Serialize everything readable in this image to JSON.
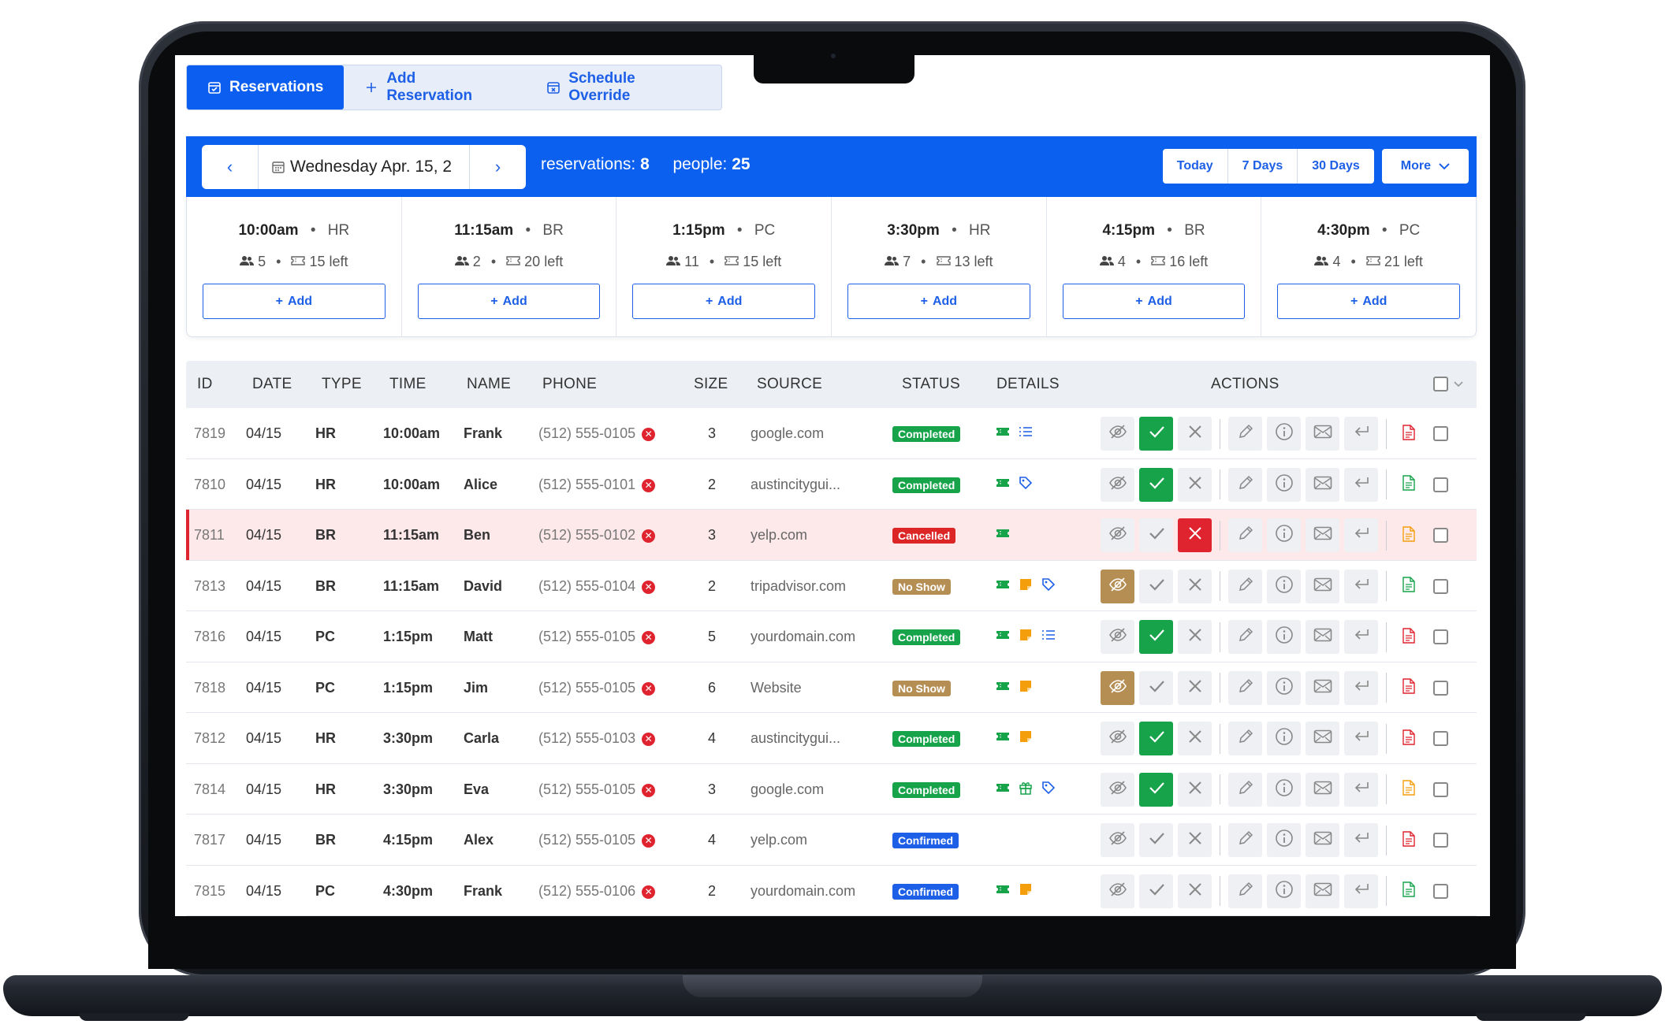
{
  "tabs": [
    {
      "label": "Reservations",
      "active": true,
      "icon": "calendar-check-icon"
    },
    {
      "label": "Add Reservation",
      "active": false,
      "icon": "plus-icon"
    },
    {
      "label": "Schedule Override",
      "active": false,
      "icon": "calendar-x-icon"
    }
  ],
  "date_nav": {
    "date_label": "Wednesday Apr. 15, 2"
  },
  "summary": {
    "reservations_label": "reservations:",
    "reservations_count": "8",
    "people_label": "people:",
    "people_count": "25"
  },
  "range_buttons": [
    "Today",
    "7 Days",
    "30 Days"
  ],
  "more_label": "More",
  "slots": [
    {
      "time": "10:00am",
      "type": "HR",
      "people": "5",
      "left": "15 left",
      "add": "Add"
    },
    {
      "time": "11:15am",
      "type": "BR",
      "people": "2",
      "left": "20 left",
      "add": "Add"
    },
    {
      "time": "1:15pm",
      "type": "PC",
      "people": "11",
      "left": "15 left",
      "add": "Add"
    },
    {
      "time": "3:30pm",
      "type": "HR",
      "people": "7",
      "left": "13 left",
      "add": "Add"
    },
    {
      "time": "4:15pm",
      "type": "BR",
      "people": "4",
      "left": "16 left",
      "add": "Add"
    },
    {
      "time": "4:30pm",
      "type": "PC",
      "people": "4",
      "left": "21 left",
      "add": "Add"
    }
  ],
  "columns": {
    "id": "ID",
    "date": "DATE",
    "type": "TYPE",
    "time": "TIME",
    "name": "NAME",
    "phone": "PHONE",
    "size": "SIZE",
    "source": "SOURCE",
    "status": "STATUS",
    "details": "DETAILS",
    "actions": "ACTIONS"
  },
  "rows": [
    {
      "id": "7819",
      "date": "04/15",
      "type": "HR",
      "time": "10:00am",
      "name": "Frank",
      "phone": "(512) 555-0105",
      "size": "3",
      "source": "google.com",
      "status": "Completed",
      "status_kind": "completed",
      "details": [
        "ticket",
        "list"
      ],
      "state": "done",
      "pdf": "red"
    },
    {
      "id": "7810",
      "date": "04/15",
      "type": "HR",
      "time": "10:00am",
      "name": "Alice",
      "phone": "(512) 555-0101",
      "size": "2",
      "source": "austincitygui...",
      "status": "Completed",
      "status_kind": "completed",
      "details": [
        "ticket",
        "tag"
      ],
      "state": "done",
      "pdf": "green"
    },
    {
      "id": "7811",
      "date": "04/15",
      "type": "BR",
      "time": "11:15am",
      "name": "Ben",
      "phone": "(512) 555-0102",
      "size": "3",
      "source": "yelp.com",
      "status": "Cancelled",
      "status_kind": "cancelled",
      "details": [
        "ticket"
      ],
      "state": "cancel",
      "pdf": "orange"
    },
    {
      "id": "7813",
      "date": "04/15",
      "type": "BR",
      "time": "11:15am",
      "name": "David",
      "phone": "(512) 555-0104",
      "size": "2",
      "source": "tripadvisor.com",
      "status": "No Show",
      "status_kind": "noshow",
      "details": [
        "ticket",
        "note",
        "tag"
      ],
      "state": "noshow",
      "pdf": "green"
    },
    {
      "id": "7816",
      "date": "04/15",
      "type": "PC",
      "time": "1:15pm",
      "name": "Matt",
      "phone": "(512) 555-0105",
      "size": "5",
      "source": "yourdomain.com",
      "status": "Completed",
      "status_kind": "completed",
      "details": [
        "ticket",
        "note",
        "list"
      ],
      "state": "done",
      "pdf": "red"
    },
    {
      "id": "7818",
      "date": "04/15",
      "type": "PC",
      "time": "1:15pm",
      "name": "Jim",
      "phone": "(512) 555-0105",
      "size": "6",
      "source": "Website",
      "status": "No Show",
      "status_kind": "noshow",
      "details": [
        "ticket",
        "note"
      ],
      "state": "noshow",
      "pdf": "red"
    },
    {
      "id": "7812",
      "date": "04/15",
      "type": "HR",
      "time": "3:30pm",
      "name": "Carla",
      "phone": "(512) 555-0103",
      "size": "4",
      "source": "austincitygui...",
      "status": "Completed",
      "status_kind": "completed",
      "details": [
        "ticket",
        "note"
      ],
      "state": "done",
      "pdf": "red"
    },
    {
      "id": "7814",
      "date": "04/15",
      "type": "HR",
      "time": "3:30pm",
      "name": "Eva",
      "phone": "(512) 555-0105",
      "size": "3",
      "source": "google.com",
      "status": "Completed",
      "status_kind": "completed",
      "details": [
        "ticket",
        "gift",
        "tag"
      ],
      "state": "done",
      "pdf": "orange"
    },
    {
      "id": "7817",
      "date": "04/15",
      "type": "BR",
      "time": "4:15pm",
      "name": "Alex",
      "phone": "(512) 555-0105",
      "size": "4",
      "source": "yelp.com",
      "status": "Confirmed",
      "status_kind": "confirmed",
      "details": [],
      "state": "none",
      "pdf": "red"
    },
    {
      "id": "7815",
      "date": "04/15",
      "type": "PC",
      "time": "4:30pm",
      "name": "Frank",
      "phone": "(512) 555-0106",
      "size": "2",
      "source": "yourdomain.com",
      "status": "Confirmed",
      "status_kind": "confirmed",
      "details": [
        "ticket",
        "note"
      ],
      "state": "none",
      "pdf": "green"
    }
  ],
  "colors": {
    "primary": "#0b60f0",
    "completed": "#16a34a",
    "cancelled": "#dc2626",
    "noshow": "#b58e54",
    "confirmed": "#1d5fe6"
  }
}
